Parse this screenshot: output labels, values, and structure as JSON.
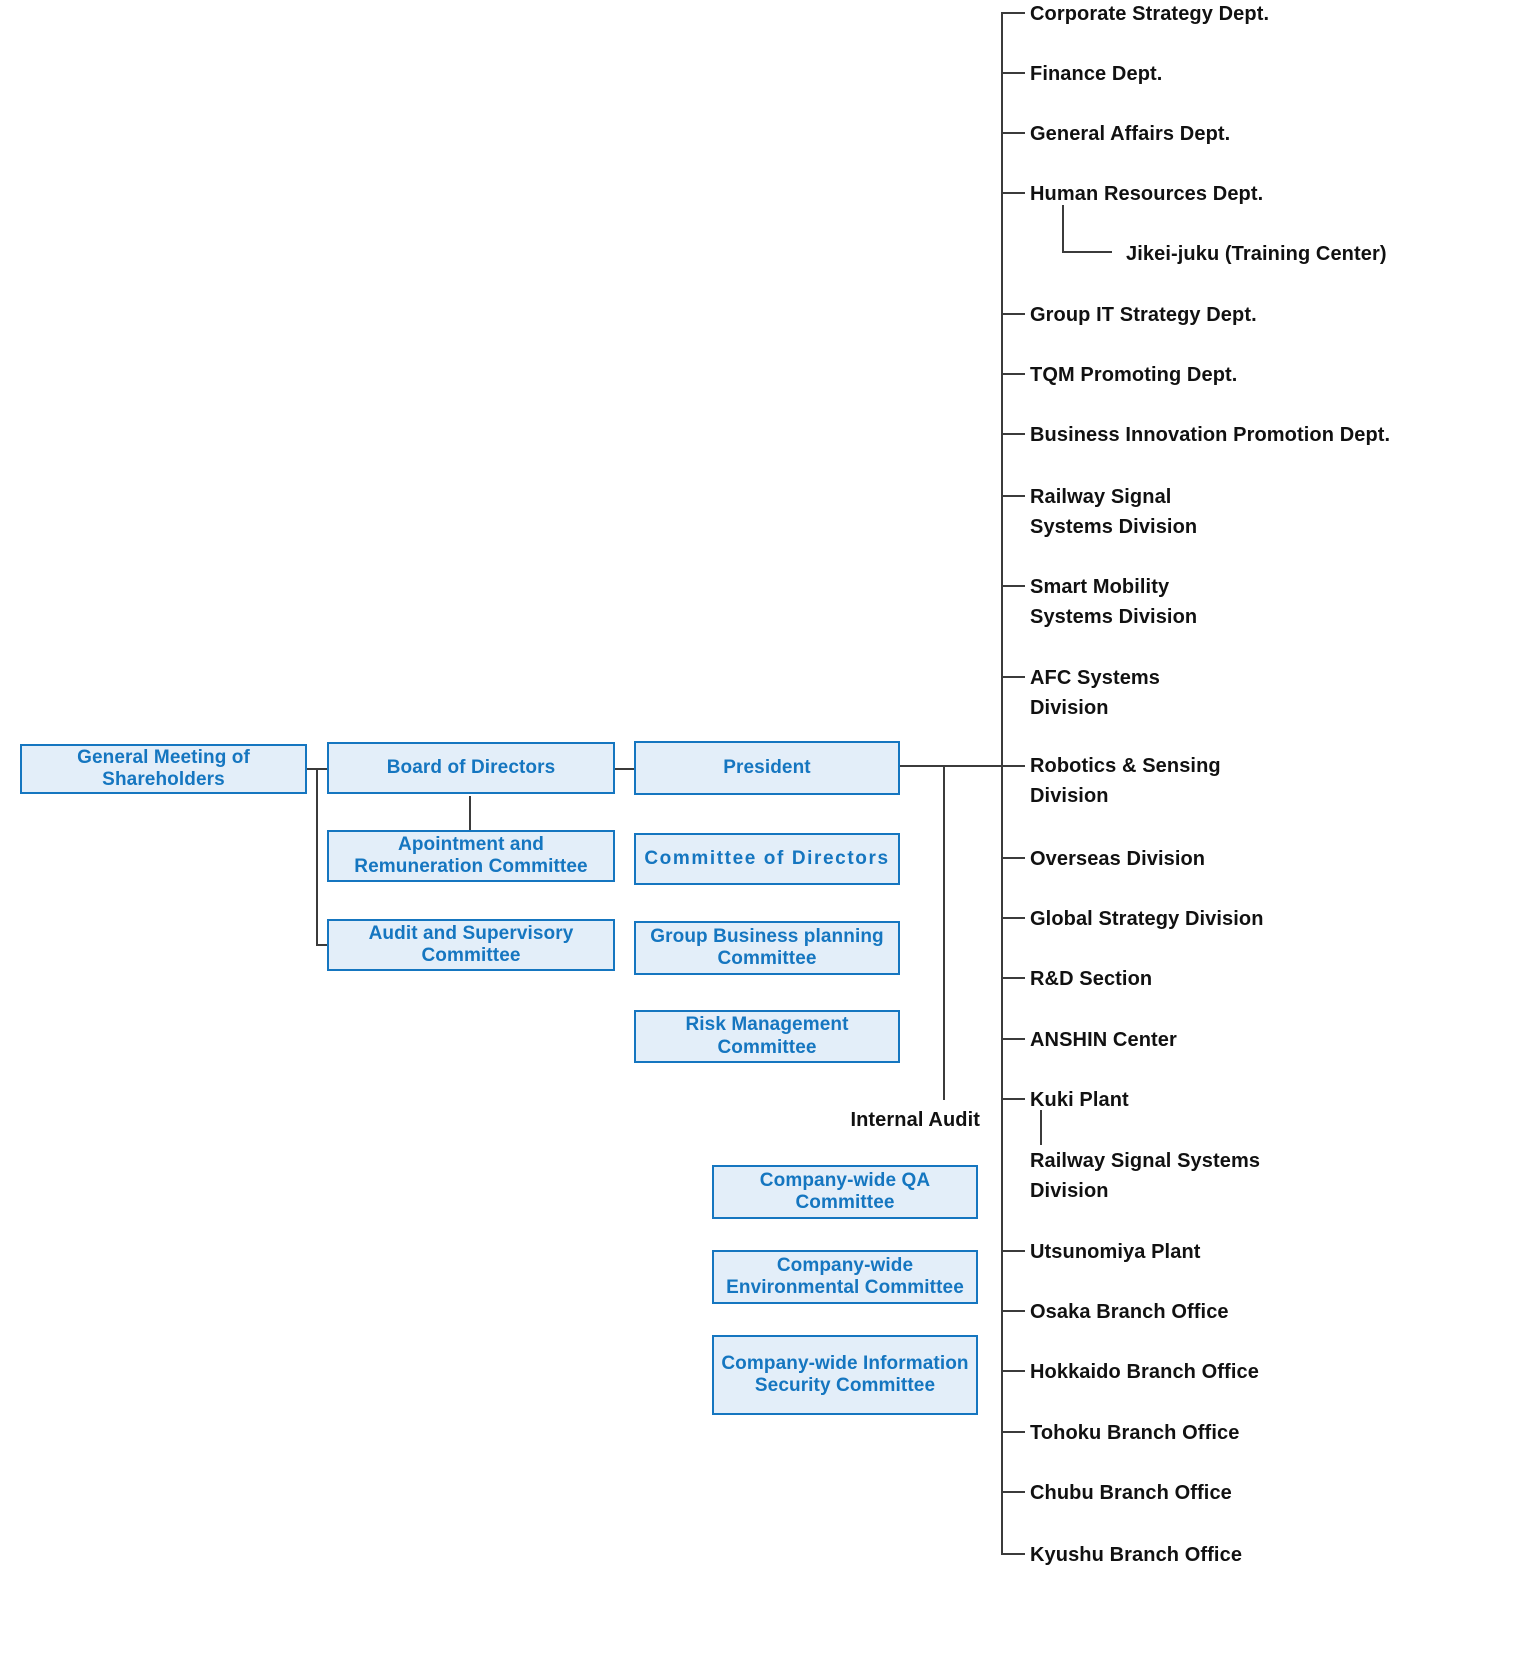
{
  "theme": {
    "box_fill": "#e3eef9",
    "box_border": "#1576c0",
    "box_text": "#1576c0",
    "leaf_text": "#111111",
    "line": "#3b3b3b",
    "background": "#ffffff"
  },
  "governance": {
    "shareholders": "General Meeting of\nShareholders",
    "board_of_directors": "Board of Directors",
    "appointment_remuneration_committee": "Apointment and\nRemuneration Committee",
    "audit_supervisory_committee": "Audit and Supervisory\nCommittee"
  },
  "executive": {
    "president": "President",
    "committee_of_directors": "Committee of Directors",
    "group_business_planning_committee": "Group Business\nplanning Committee",
    "risk_management_committee": "Risk Management\nCommittee",
    "internal_audit": "Internal Audit"
  },
  "company_wide_committees": [
    {
      "label": "Company-wide\nQA Committee"
    },
    {
      "label": "Company-wide\nEnvironmental Committee"
    },
    {
      "label": "Company-wide\nInformation Security\nCommittee"
    }
  ],
  "divisions": [
    {
      "label": "Corporate Strategy Dept."
    },
    {
      "label": "Finance Dept."
    },
    {
      "label": "General Affairs Dept."
    },
    {
      "label": "Human Resources Dept."
    },
    {
      "label": "Jikei-juku (Training Center)"
    },
    {
      "label": "Group IT Strategy Dept."
    },
    {
      "label": "TQM Promoting Dept."
    },
    {
      "label": "Business Innovation Promotion Dept."
    },
    {
      "label": "Railway Signal\nSystems Division"
    },
    {
      "label": "Smart Mobility\nSystems Division"
    },
    {
      "label": "AFC Systems\nDivision"
    },
    {
      "label": "Robotics & Sensing\nDivision"
    },
    {
      "label": "Overseas Division"
    },
    {
      "label": "Global Strategy Division"
    },
    {
      "label": "R&D Section"
    },
    {
      "label": "ANSHIN Center"
    },
    {
      "label": "Kuki Plant"
    },
    {
      "label": "Railway Signal Systems\nDivision"
    },
    {
      "label": "Utsunomiya Plant"
    },
    {
      "label": "Osaka Branch Office"
    },
    {
      "label": "Hokkaido Branch Office"
    },
    {
      "label": "Tohoku Branch Office"
    },
    {
      "label": "Chubu Branch Office"
    },
    {
      "label": "Kyushu Branch Office"
    }
  ]
}
